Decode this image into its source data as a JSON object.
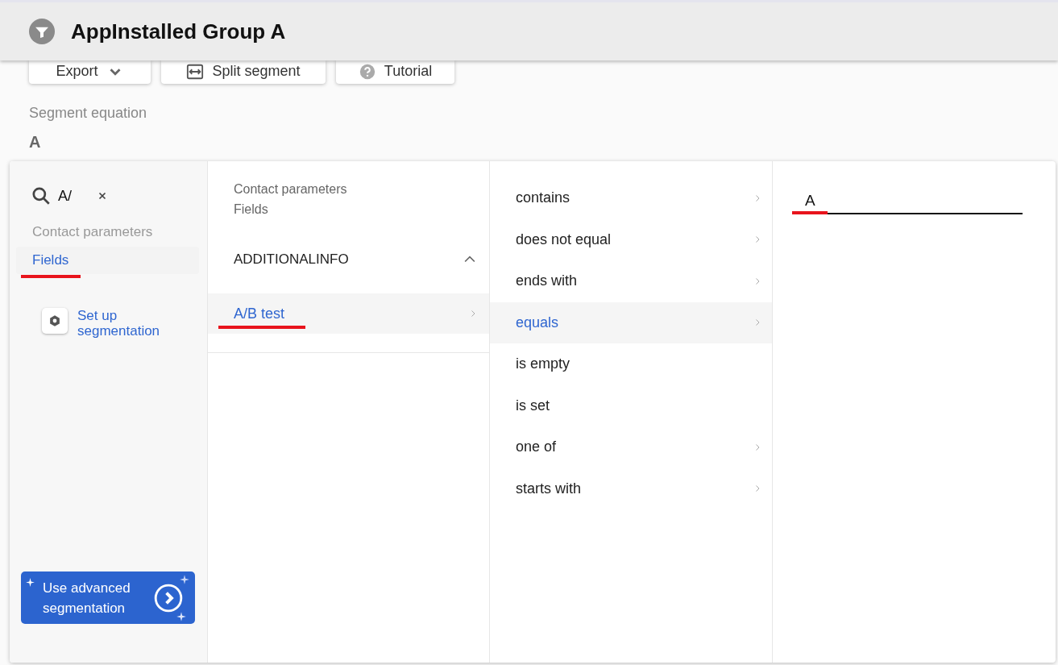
{
  "header": {
    "title": "AppInstalled Group A"
  },
  "toolbar": [
    {
      "label": "Export"
    },
    {
      "label": "Split segment"
    },
    {
      "label": "Tutorial"
    }
  ],
  "equation": {
    "label": "Segment equation",
    "value": "A"
  },
  "sidebar": {
    "search": {
      "value": "A/"
    },
    "category": "Contact parameters",
    "items": [
      {
        "label": "Fields",
        "selected": true,
        "underlined": true
      }
    ],
    "setup_link": "Set up segmentation",
    "advanced_button": "Use advanced segmentation"
  },
  "fields_column": {
    "breadcrumb": [
      "Contact parameters",
      "Fields"
    ],
    "group": {
      "label": "ADDITIONALINFO",
      "expanded": true
    },
    "items": [
      {
        "label": "A/B test",
        "selected": true,
        "underlined": true
      }
    ]
  },
  "operators": [
    {
      "label": "contains",
      "selected": false,
      "has_submenu": true
    },
    {
      "label": "does not equal",
      "selected": false,
      "has_submenu": true
    },
    {
      "label": "ends with",
      "selected": false,
      "has_submenu": true
    },
    {
      "label": "equals",
      "selected": true,
      "has_submenu": true
    },
    {
      "label": "is empty",
      "selected": false,
      "has_submenu": false
    },
    {
      "label": "is set",
      "selected": false,
      "has_submenu": false
    },
    {
      "label": "one of",
      "selected": false,
      "has_submenu": true
    },
    {
      "label": "starts with",
      "selected": false,
      "has_submenu": true
    }
  ],
  "value_field": {
    "value": "A",
    "underlined": true
  }
}
